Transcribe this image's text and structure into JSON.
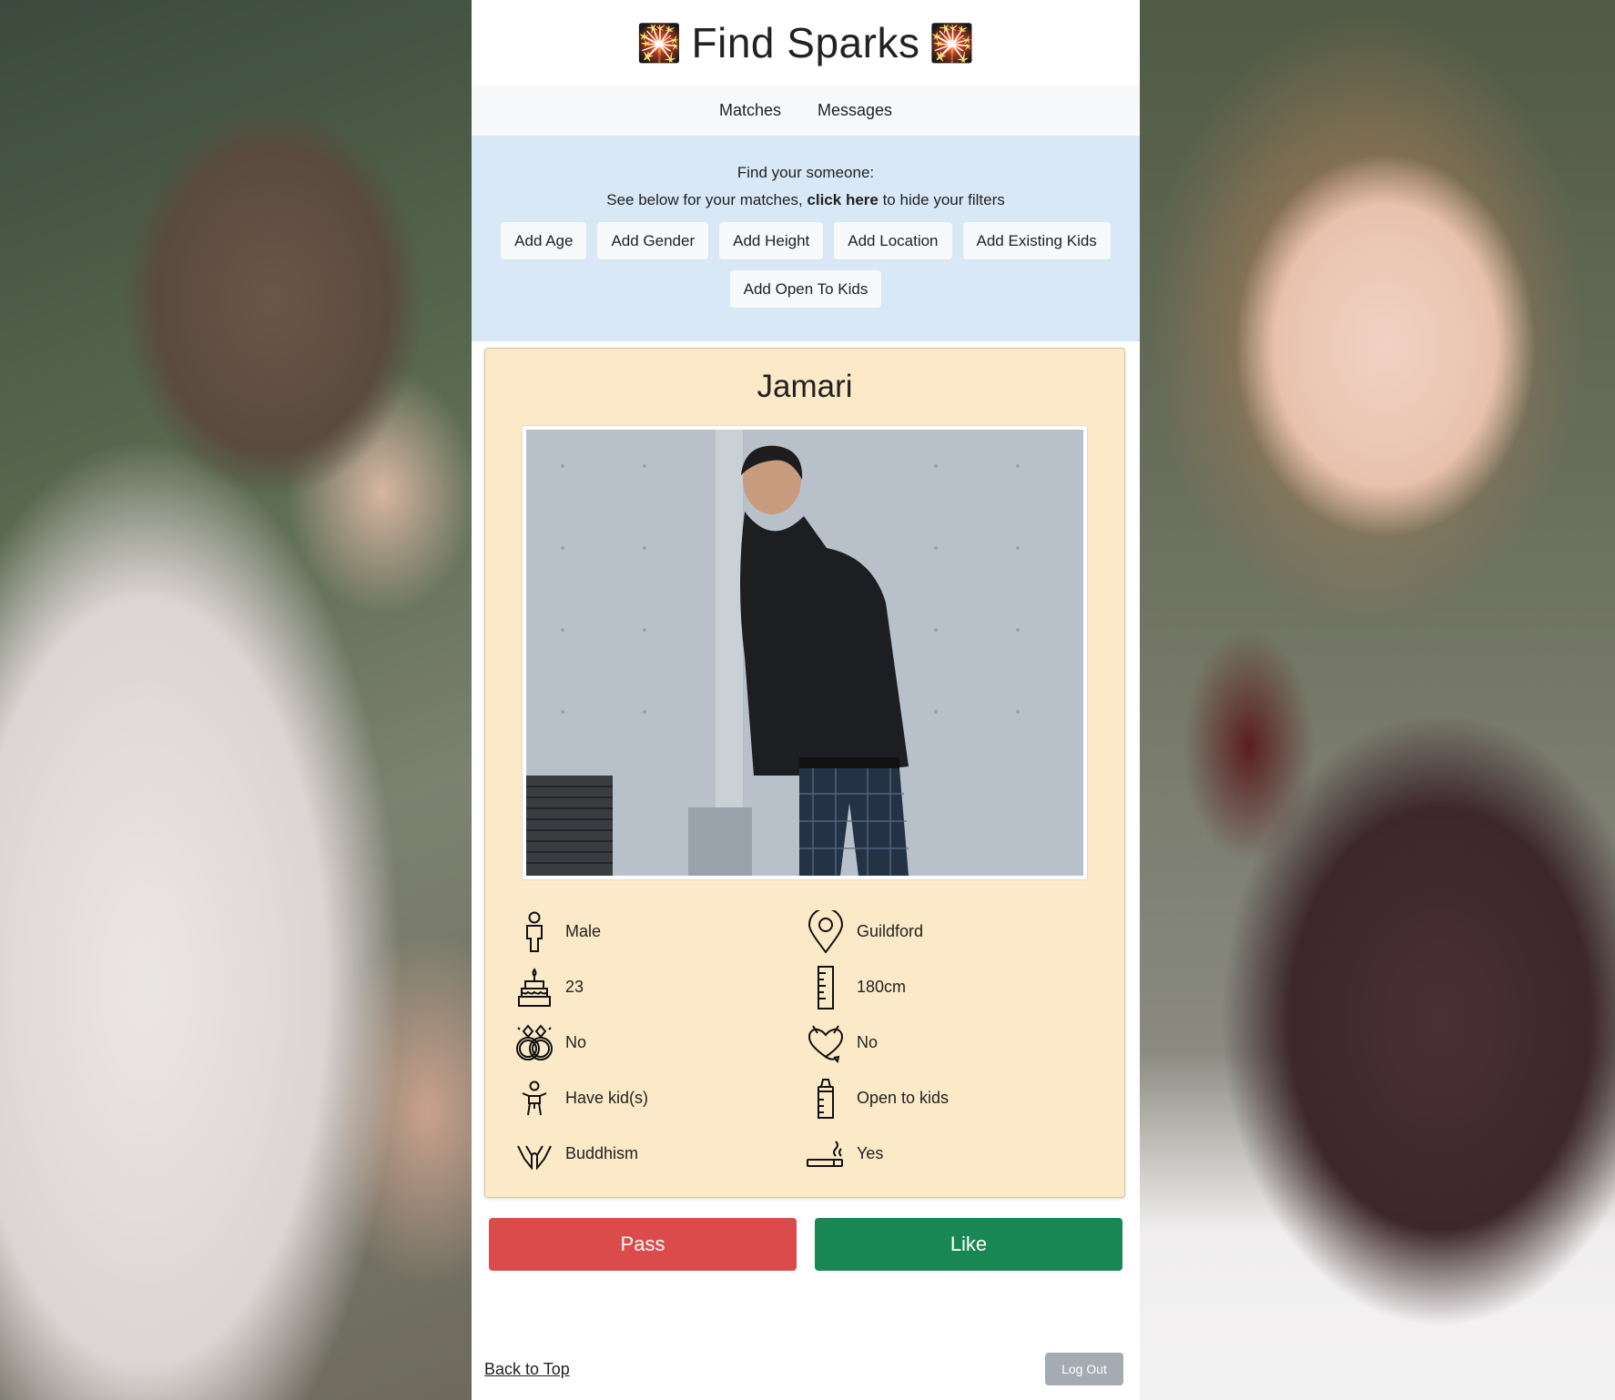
{
  "brand": {
    "title": "Find Sparks",
    "spark_left": "🎇",
    "spark_right": "🎇"
  },
  "nav": {
    "matches": "Matches",
    "messages": "Messages"
  },
  "filters": {
    "title": "Find your someone:",
    "sub_before": "See below for your matches, ",
    "sub_link": "click here",
    "sub_after": " to hide your filters",
    "buttons": [
      "Add Age",
      "Add Gender",
      "Add Height",
      "Add Location",
      "Add Existing Kids",
      "Add Open To Kids"
    ]
  },
  "profile": {
    "name": "Jamari",
    "gender": "Male",
    "location": "Guildford",
    "age": "23",
    "height": "180cm",
    "married": "No",
    "flirt": "No",
    "have_kids": "Have kid(s)",
    "open_to_kids": "Open to kids",
    "religion": "Buddhism",
    "smoking": "Yes"
  },
  "actions": {
    "pass": "Pass",
    "like": "Like"
  },
  "footer": {
    "back_to_top": "Back to Top",
    "logout": "Log Out"
  },
  "colors": {
    "pass": "#dc4b4b",
    "like": "#198754",
    "card": "#fbe9c8",
    "filters_bg": "#d8e8f6"
  }
}
